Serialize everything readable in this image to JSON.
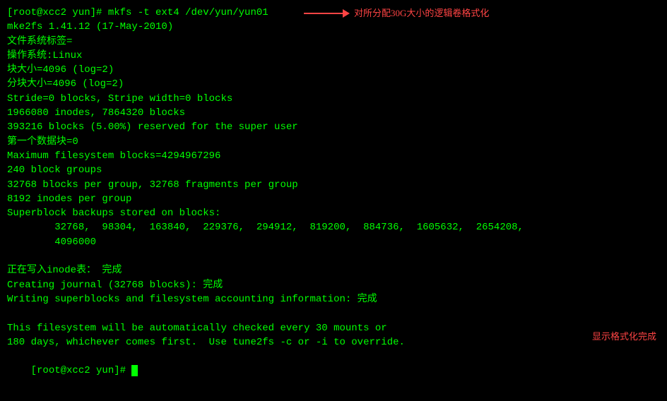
{
  "terminal": {
    "background": "#000000",
    "text_color": "#00FF00",
    "lines": [
      {
        "id": "line1",
        "text": "[root@xcc2 yun]# mkfs -t ext4 /dev/yun/yun01",
        "color": "green"
      },
      {
        "id": "line2",
        "text": "mke2fs 1.41.12 (17-May-2010)",
        "color": "green"
      },
      {
        "id": "line3",
        "text": "文件系统标签=",
        "color": "green"
      },
      {
        "id": "line4",
        "text": "操作系统:Linux",
        "color": "green"
      },
      {
        "id": "line5",
        "text": "块大小=4096 (log=2)",
        "color": "green"
      },
      {
        "id": "line6",
        "text": "分块大小=4096 (log=2)",
        "color": "green"
      },
      {
        "id": "line7",
        "text": "Stride=0 blocks, Stripe width=0 blocks",
        "color": "green"
      },
      {
        "id": "line8",
        "text": "1966080 inodes, 7864320 blocks",
        "color": "green"
      },
      {
        "id": "line9",
        "text": "393216 blocks (5.00%) reserved for the super user",
        "color": "green"
      },
      {
        "id": "line10",
        "text": "第一个数据块=0",
        "color": "green"
      },
      {
        "id": "line11",
        "text": "Maximum filesystem blocks=4294967296",
        "color": "green"
      },
      {
        "id": "line12",
        "text": "240 block groups",
        "color": "green"
      },
      {
        "id": "line13",
        "text": "32768 blocks per group, 32768 fragments per group",
        "color": "green"
      },
      {
        "id": "line14",
        "text": "8192 inodes per group",
        "color": "green"
      },
      {
        "id": "line15",
        "text": "Superblock backups stored on blocks:",
        "color": "green"
      },
      {
        "id": "line16",
        "text": "        32768,  98304,  163840,  229376,  294912,  819200,  884736,  1605632,  2654208,",
        "color": "green"
      },
      {
        "id": "line17",
        "text": "        4096000",
        "color": "green"
      },
      {
        "id": "line18",
        "text": "",
        "color": "green"
      },
      {
        "id": "line19",
        "text": "正在写入inode表： 完成",
        "color": "green"
      },
      {
        "id": "line20",
        "text": "Creating journal (32768 blocks): 完成",
        "color": "green"
      },
      {
        "id": "line21",
        "text": "Writing superblocks and filesystem accounting information: 完成",
        "color": "green"
      },
      {
        "id": "line22",
        "text": "",
        "color": "green"
      },
      {
        "id": "line23",
        "text": "This filesystem will be automatically checked every 30 mounts or",
        "color": "green"
      },
      {
        "id": "line24",
        "text": "180 days, whichever comes first.  Use tune2fs -c or -i to override.",
        "color": "green"
      },
      {
        "id": "line25",
        "text": "[root@xcc2 yun]# ",
        "color": "green"
      }
    ],
    "cursor": true
  },
  "annotations": {
    "top": {
      "text": "对所分配30G大小的逻辑卷格式化",
      "color": "#FF4444"
    },
    "bottom": {
      "text": "显示格式化完成",
      "color": "#FF4444"
    }
  }
}
